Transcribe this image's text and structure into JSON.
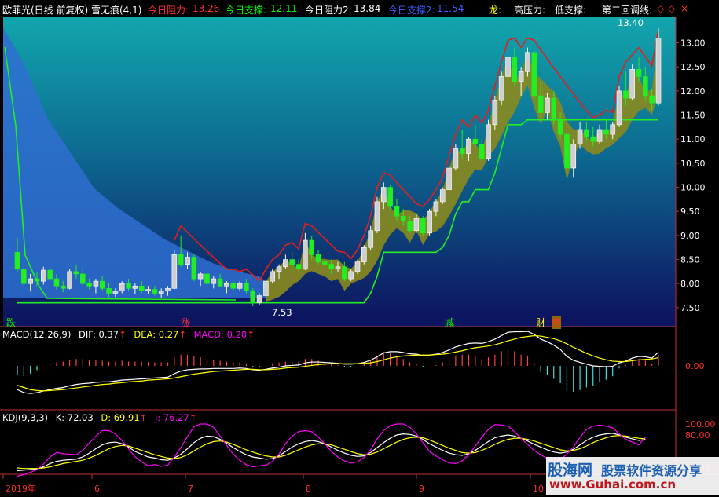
{
  "header": {
    "title": "欧菲光(日线 前复权) 雪无痕(4,1)",
    "items": [
      {
        "label": "今日阻力:",
        "value": "13.26",
        "color": "#ff3030"
      },
      {
        "label": "今日支撑:",
        "value": "12.11",
        "color": "#00ff00"
      },
      {
        "label": "今日阻力2:",
        "value": "13.84",
        "color": "#ffffff"
      },
      {
        "label": "今日支撑2:",
        "value": "11.54",
        "color": "#3d5cff"
      },
      {
        "label": "龙:",
        "value": "-",
        "color": "#ffff00"
      },
      {
        "label": "高压力:",
        "value": "-",
        "color": "#ffffff"
      },
      {
        "label": "低支撑:",
        "value": "-",
        "color": "#ffffff"
      },
      {
        "label": "第二回调线:",
        "value": "",
        "color": "#ffffff"
      }
    ]
  },
  "price_panel": {
    "high_label": "13.40",
    "low_label": "7.53",
    "markers": [
      {
        "text": "跌",
        "color": "#00ff00"
      },
      {
        "text": "涨",
        "color": "#ff3030"
      },
      {
        "text": "减",
        "color": "#00ff00"
      },
      {
        "text": "财",
        "color": "#ffff00"
      },
      {
        "text": "榜",
        "color": "#ff3030"
      }
    ]
  },
  "macd_panel": {
    "label": "MACD(12,26,9)",
    "dif": "DIF: 0.37",
    "dea": "DEA: 0.27",
    "macd": "MACD: 0.20",
    "axis": [
      "0.00"
    ]
  },
  "kdj_panel": {
    "label": "KDJ(9,3,3)",
    "k": "K: 72.03",
    "d": "D: 69.91",
    "j": "J: 76.27",
    "axis": [
      "100.00",
      "80.00",
      "20.00"
    ]
  },
  "time_axis": [
    "2019年",
    "6",
    "7",
    "8",
    "9",
    "10"
  ],
  "watermark": {
    "brand": "股海网",
    "slogan": "股票软件资源分享",
    "url": "www.Guhai.com.cn"
  },
  "chart_data": [
    {
      "type": "candlestick",
      "title": "欧菲光(日线 前复权)",
      "ylim": [
        7.4,
        13.4
      ],
      "yticks": [
        7.5,
        8.0,
        8.5,
        9.0,
        9.5,
        10.0,
        10.5,
        11.0,
        11.5,
        12.0,
        12.5,
        13.0
      ],
      "ohlc": [
        [
          8.65,
          8.95,
          8.25,
          8.3
        ],
        [
          8.3,
          8.4,
          7.95,
          8.0
        ],
        [
          8.0,
          8.2,
          7.85,
          8.1
        ],
        [
          8.1,
          8.25,
          7.95,
          8.05
        ],
        [
          8.05,
          8.35,
          7.98,
          8.28
        ],
        [
          8.28,
          8.35,
          8.05,
          8.1
        ],
        [
          8.1,
          8.2,
          7.88,
          7.95
        ],
        [
          7.95,
          8.05,
          7.82,
          7.9
        ],
        [
          7.9,
          8.3,
          7.88,
          8.25
        ],
        [
          8.25,
          8.4,
          8.1,
          8.2
        ],
        [
          8.2,
          8.35,
          7.95,
          8.0
        ],
        [
          8.0,
          8.1,
          7.88,
          7.95
        ],
        [
          7.95,
          8.1,
          7.8,
          8.05
        ],
        [
          8.05,
          8.15,
          7.85,
          7.9
        ],
        [
          7.9,
          8.0,
          7.72,
          7.8
        ],
        [
          7.8,
          7.9,
          7.72,
          7.85
        ],
        [
          7.85,
          8.05,
          7.8,
          8.0
        ],
        [
          8.0,
          8.1,
          7.85,
          7.9
        ],
        [
          7.9,
          8.0,
          7.78,
          7.95
        ],
        [
          7.95,
          8.05,
          7.8,
          7.85
        ],
        [
          7.85,
          7.95,
          7.78,
          7.88
        ],
        [
          7.88,
          7.95,
          7.75,
          7.8
        ],
        [
          7.8,
          7.9,
          7.7,
          7.85
        ],
        [
          7.85,
          7.95,
          7.75,
          7.9
        ],
        [
          7.9,
          8.7,
          7.88,
          8.6
        ],
        [
          8.6,
          9.0,
          8.35,
          8.4
        ],
        [
          8.4,
          8.65,
          8.3,
          8.55
        ],
        [
          8.55,
          8.6,
          8.05,
          8.1
        ],
        [
          8.1,
          8.25,
          7.95,
          8.2
        ],
        [
          8.2,
          8.3,
          7.98,
          8.0
        ],
        [
          8.0,
          8.15,
          7.9,
          8.1
        ],
        [
          8.1,
          8.2,
          7.92,
          7.95
        ],
        [
          7.95,
          8.05,
          7.8,
          8.0
        ],
        [
          8.0,
          8.1,
          7.85,
          7.9
        ],
        [
          7.9,
          8.05,
          7.85,
          8.0
        ],
        [
          8.0,
          8.1,
          7.8,
          7.85
        ],
        [
          7.85,
          7.9,
          7.53,
          7.6
        ],
        [
          7.6,
          7.8,
          7.55,
          7.75
        ],
        [
          7.75,
          8.1,
          7.7,
          8.05
        ],
        [
          8.05,
          8.3,
          8.0,
          8.25
        ],
        [
          8.25,
          8.4,
          8.1,
          8.35
        ],
        [
          8.35,
          8.6,
          8.3,
          8.5
        ],
        [
          8.5,
          8.65,
          8.3,
          8.4
        ],
        [
          8.4,
          8.5,
          8.25,
          8.3
        ],
        [
          8.3,
          9.05,
          8.28,
          8.9
        ],
        [
          8.9,
          9.0,
          8.5,
          8.6
        ],
        [
          8.6,
          8.7,
          8.4,
          8.45
        ],
        [
          8.45,
          8.55,
          8.35,
          8.4
        ],
        [
          8.4,
          8.5,
          8.2,
          8.3
        ],
        [
          8.3,
          8.45,
          8.25,
          8.35
        ],
        [
          8.35,
          8.45,
          8.05,
          8.1
        ],
        [
          8.1,
          8.3,
          8.05,
          8.25
        ],
        [
          8.25,
          8.5,
          8.2,
          8.45
        ],
        [
          8.45,
          8.8,
          8.4,
          8.75
        ],
        [
          8.75,
          9.2,
          8.7,
          9.1
        ],
        [
          9.1,
          9.8,
          9.05,
          9.7
        ],
        [
          9.7,
          10.1,
          9.55,
          10.0
        ],
        [
          10.0,
          10.05,
          9.55,
          9.6
        ],
        [
          9.6,
          9.75,
          9.3,
          9.4
        ],
        [
          9.4,
          9.55,
          9.2,
          9.3
        ],
        [
          9.3,
          9.4,
          9.05,
          9.1
        ],
        [
          9.1,
          9.45,
          9.05,
          9.35
        ],
        [
          9.35,
          9.4,
          9.0,
          9.05
        ],
        [
          9.05,
          9.55,
          9.0,
          9.5
        ],
        [
          9.5,
          9.75,
          9.4,
          9.7
        ],
        [
          9.7,
          10.0,
          9.65,
          9.95
        ],
        [
          9.95,
          10.45,
          9.9,
          10.4
        ],
        [
          10.4,
          10.9,
          10.35,
          10.8
        ],
        [
          10.8,
          11.2,
          10.6,
          10.7
        ],
        [
          10.7,
          11.05,
          10.55,
          11.0
        ],
        [
          11.0,
          11.3,
          10.85,
          10.9
        ],
        [
          10.9,
          11.0,
          10.55,
          10.6
        ],
        [
          10.6,
          11.4,
          10.55,
          11.3
        ],
        [
          11.3,
          11.9,
          11.2,
          11.8
        ],
        [
          11.8,
          12.4,
          11.7,
          12.3
        ],
        [
          12.3,
          12.85,
          12.2,
          12.7
        ],
        [
          12.7,
          12.9,
          12.1,
          12.2
        ],
        [
          12.2,
          12.5,
          11.9,
          12.4
        ],
        [
          12.4,
          12.9,
          12.3,
          12.8
        ],
        [
          12.8,
          12.85,
          11.8,
          11.9
        ],
        [
          11.9,
          12.2,
          11.45,
          11.55
        ],
        [
          11.55,
          11.95,
          11.4,
          11.85
        ],
        [
          11.85,
          12.0,
          11.3,
          11.4
        ],
        [
          11.4,
          11.55,
          11.0,
          11.1
        ],
        [
          11.1,
          11.2,
          10.2,
          10.4
        ],
        [
          10.4,
          11.0,
          10.2,
          10.9
        ],
        [
          10.9,
          11.35,
          10.8,
          11.2
        ],
        [
          11.2,
          11.35,
          10.95,
          11.05
        ],
        [
          11.05,
          11.25,
          10.85,
          10.95
        ],
        [
          10.95,
          11.3,
          10.9,
          11.2
        ],
        [
          11.2,
          11.4,
          11.0,
          11.1
        ],
        [
          11.1,
          11.35,
          11.0,
          11.3
        ],
        [
          11.3,
          12.1,
          11.25,
          12.0
        ],
        [
          12.0,
          12.4,
          11.7,
          11.85
        ],
        [
          11.85,
          12.55,
          11.8,
          12.45
        ],
        [
          12.45,
          12.7,
          12.2,
          12.3
        ],
        [
          12.3,
          12.5,
          11.8,
          11.9
        ],
        [
          11.9,
          12.05,
          11.6,
          11.75
        ],
        [
          11.75,
          13.3,
          11.7,
          13.1
        ]
      ]
    },
    {
      "type": "line",
      "title": "MACD(12,26,9)",
      "series": [
        {
          "name": "DIF",
          "values": [
            -0.55,
            -0.62,
            -0.64,
            -0.62,
            -0.58,
            -0.55,
            -0.52,
            -0.5,
            -0.46,
            -0.43,
            -0.41,
            -0.4,
            -0.38,
            -0.37,
            -0.37,
            -0.35,
            -0.33,
            -0.32,
            -0.31,
            -0.3,
            -0.29,
            -0.28,
            -0.27,
            -0.26,
            -0.18,
            -0.12,
            -0.09,
            -0.08,
            -0.07,
            -0.07,
            -0.06,
            -0.06,
            -0.06,
            -0.06,
            -0.05,
            -0.06,
            -0.09,
            -0.1,
            -0.08,
            -0.05,
            -0.03,
            0.0,
            0.01,
            0.02,
            0.07,
            0.09,
            0.09,
            0.08,
            0.07,
            0.06,
            0.04,
            0.04,
            0.05,
            0.08,
            0.13,
            0.21,
            0.3,
            0.33,
            0.33,
            0.31,
            0.28,
            0.27,
            0.24,
            0.25,
            0.27,
            0.31,
            0.37,
            0.44,
            0.48,
            0.52,
            0.53,
            0.52,
            0.56,
            0.62,
            0.7,
            0.78,
            0.79,
            0.79,
            0.8,
            0.73,
            0.62,
            0.56,
            0.48,
            0.38,
            0.22,
            0.13,
            0.08,
            0.04,
            0.0,
            -0.01,
            -0.02,
            -0.01,
            0.07,
            0.11,
            0.18,
            0.22,
            0.21,
            0.18,
            0.32
          ]
        },
        {
          "name": "DEA",
          "values": [
            -0.45,
            -0.5,
            -0.55,
            -0.57,
            -0.58,
            -0.57,
            -0.56,
            -0.55,
            -0.53,
            -0.51,
            -0.49,
            -0.47,
            -0.45,
            -0.43,
            -0.42,
            -0.4,
            -0.39,
            -0.37,
            -0.36,
            -0.35,
            -0.33,
            -0.32,
            -0.31,
            -0.3,
            -0.28,
            -0.25,
            -0.22,
            -0.19,
            -0.17,
            -0.15,
            -0.13,
            -0.12,
            -0.11,
            -0.1,
            -0.09,
            -0.08,
            -0.08,
            -0.09,
            -0.09,
            -0.08,
            -0.07,
            -0.05,
            -0.04,
            -0.03,
            -0.01,
            0.01,
            0.03,
            0.04,
            0.05,
            0.05,
            0.05,
            0.05,
            0.05,
            0.06,
            0.07,
            0.1,
            0.14,
            0.18,
            0.21,
            0.23,
            0.24,
            0.25,
            0.25,
            0.25,
            0.26,
            0.27,
            0.29,
            0.32,
            0.35,
            0.39,
            0.42,
            0.44,
            0.46,
            0.49,
            0.53,
            0.58,
            0.62,
            0.66,
            0.68,
            0.7,
            0.69,
            0.66,
            0.63,
            0.58,
            0.51,
            0.43,
            0.36,
            0.29,
            0.23,
            0.18,
            0.14,
            0.11,
            0.1,
            0.1,
            0.12,
            0.14,
            0.15,
            0.16,
            0.19
          ]
        }
      ],
      "axis_label": "0.00"
    },
    {
      "type": "line",
      "title": "KDJ(9,3,3)",
      "ylim": [
        0,
        100
      ],
      "yticks": [
        20,
        80,
        100
      ],
      "series": [
        {
          "name": "K",
          "values": [
            15,
            16,
            17,
            18,
            22,
            28,
            32,
            34,
            35,
            36,
            40,
            47,
            55,
            62,
            66,
            67,
            64,
            58,
            50,
            45,
            40,
            38,
            35,
            34,
            38,
            45,
            55,
            66,
            74,
            78,
            77,
            72,
            65,
            57,
            50,
            44,
            40,
            38,
            36,
            37,
            42,
            50,
            58,
            64,
            68,
            70,
            68,
            64,
            58,
            52,
            47,
            43,
            41,
            42,
            48,
            57,
            66,
            74,
            80,
            82,
            81,
            78,
            72,
            64,
            58,
            52,
            47,
            44,
            43,
            46,
            52,
            60,
            68,
            75,
            78,
            80,
            78,
            74,
            69,
            63,
            58,
            53,
            49,
            47,
            49,
            54,
            62,
            70,
            76,
            80,
            82,
            83,
            80,
            76,
            73,
            70,
            72
          ]
        },
        {
          "name": "D",
          "values": [
            20,
            19,
            19,
            19,
            20,
            22,
            25,
            28,
            30,
            32,
            34,
            38,
            43,
            49,
            55,
            59,
            61,
            60,
            56,
            52,
            48,
            44,
            41,
            38,
            37,
            39,
            44,
            51,
            58,
            64,
            68,
            69,
            67,
            63,
            58,
            53,
            49,
            45,
            42,
            40,
            40,
            43,
            48,
            53,
            58,
            62,
            64,
            64,
            62,
            58,
            54,
            50,
            46,
            44,
            45,
            49,
            55,
            61,
            67,
            72,
            75,
            76,
            75,
            71,
            66,
            61,
            56,
            52,
            48,
            47,
            48,
            52,
            57,
            63,
            68,
            72,
            74,
            74,
            72,
            69,
            65,
            61,
            57,
            53,
            51,
            52,
            55,
            60,
            66,
            71,
            75,
            78,
            79,
            78,
            76,
            74,
            73
          ]
        },
        {
          "name": "J",
          "values": [
            5,
            8,
            12,
            17,
            27,
            40,
            48,
            46,
            45,
            44,
            52,
            65,
            78,
            88,
            88,
            82,
            70,
            55,
            40,
            31,
            24,
            26,
            23,
            25,
            40,
            57,
            77,
            95,
            100,
            100,
            94,
            78,
            61,
            45,
            34,
            26,
            22,
            24,
            25,
            32,
            45,
            64,
            78,
            86,
            88,
            86,
            76,
            64,
            50,
            40,
            33,
            29,
            31,
            39,
            53,
            73,
            88,
            97,
            100,
            100,
            94,
            82,
            66,
            50,
            42,
            35,
            29,
            28,
            33,
            44,
            60,
            76,
            90,
            99,
            98,
            96,
            86,
            74,
            63,
            52,
            44,
            37,
            33,
            35,
            45,
            58,
            76,
            90,
            96,
            98,
            96,
            93,
            82,
            72,
            67,
            62,
            76
          ]
        }
      ]
    }
  ]
}
